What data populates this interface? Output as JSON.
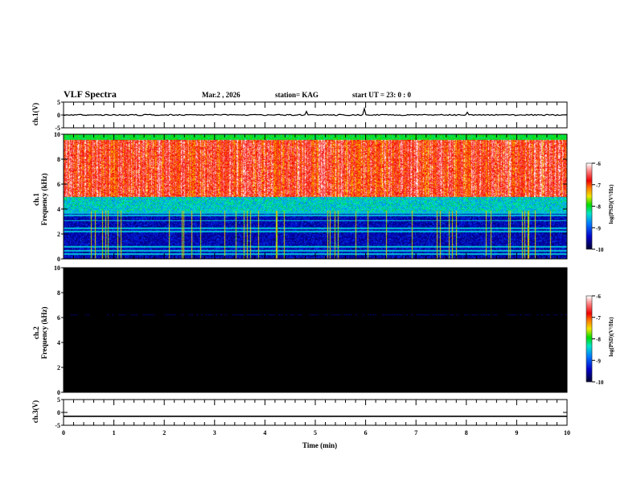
{
  "header": {
    "title": "VLF Spectra",
    "date": "Mar.2  , 2026",
    "station": "station= KAG",
    "start": "start  UT  =   23: 0  : 0"
  },
  "chart_data": [
    {
      "type": "line",
      "ylabel": "ch.1(V)",
      "ylim": [
        -5,
        5
      ],
      "yticks": [
        "5",
        "0",
        "-5"
      ],
      "xlim": [
        0,
        10
      ],
      "baseline": 0
    },
    {
      "type": "heatmap",
      "ylabel_1": "ch.1",
      "ylabel_2": "Frequency (kHz)",
      "ylim": [
        0,
        10
      ],
      "yticks": [
        "0",
        "2",
        "4",
        "6",
        "8",
        "10"
      ],
      "xlim": [
        0,
        10
      ],
      "colorbar": {
        "label": "log(PSD)(V²/Hz)",
        "range": [
          -10,
          -6
        ],
        "ticks": [
          "-6",
          "-7",
          "-8",
          "-9",
          "-10"
        ]
      }
    },
    {
      "type": "heatmap",
      "ylabel_1": "ch.2",
      "ylabel_2": "Frequency (kHz)",
      "ylim": [
        0,
        10
      ],
      "yticks": [
        "0",
        "2",
        "4",
        "6",
        "8",
        "10"
      ],
      "xlim": [
        0,
        10
      ],
      "colorbar": {
        "label": "log(PSD)(V²/Hz)",
        "range": [
          -10,
          -6
        ],
        "ticks": [
          "-6",
          "-7",
          "-8",
          "-9",
          "-10"
        ]
      }
    },
    {
      "type": "line",
      "ylabel": "ch.3(V)",
      "ylim": [
        -5,
        5
      ],
      "yticks": [
        "5",
        "0",
        "-5"
      ],
      "xlim": [
        0,
        10
      ],
      "baseline": -1.5
    }
  ],
  "xaxis": {
    "label": "Time  (min)",
    "ticks": [
      "0",
      "1",
      "2",
      "3",
      "4",
      "5",
      "6",
      "7",
      "8",
      "9",
      "10"
    ]
  }
}
